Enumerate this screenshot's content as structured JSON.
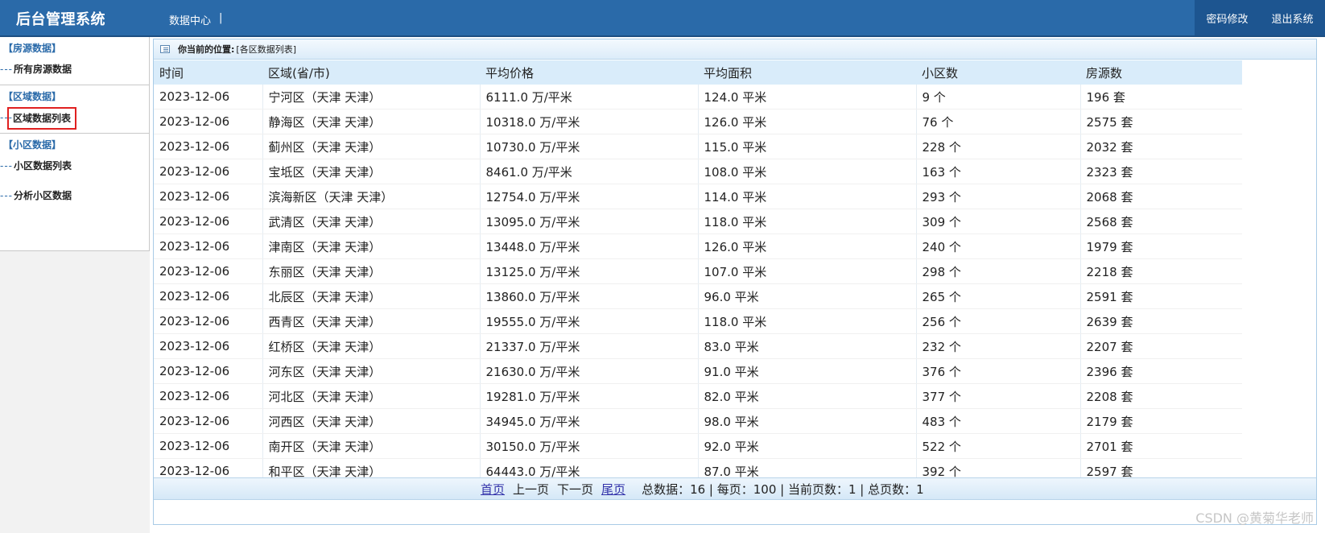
{
  "header": {
    "app_title": "后台管理系统",
    "nav_label": "数据中心",
    "nav_sep": "|",
    "change_password": "密码修改",
    "logout": "退出系统"
  },
  "sidebar": {
    "groups": [
      {
        "title": "【房源数据】",
        "items": [
          {
            "label": "所有房源数据",
            "active": false
          }
        ]
      },
      {
        "title": "【区域数据】",
        "items": [
          {
            "label": "区域数据列表",
            "active": true
          }
        ]
      },
      {
        "title": "【小区数据】",
        "items": [
          {
            "label": "小区数据列表",
            "active": false
          },
          {
            "label": "分析小区数据",
            "active": false
          }
        ]
      }
    ],
    "dash": "---"
  },
  "breadcrumb": {
    "prefix": "你当前的位置:",
    "path": "[各区数据列表]"
  },
  "table": {
    "columns": [
      "时间",
      "区域(省/市)",
      "平均价格",
      "平均面积",
      "小区数",
      "房源数"
    ],
    "rows": [
      [
        "2023-12-06",
        "宁河区（天津 天津）",
        "6111.0 万/平米",
        "124.0 平米",
        "9 个",
        "196 套"
      ],
      [
        "2023-12-06",
        "静海区（天津 天津）",
        "10318.0 万/平米",
        "126.0 平米",
        "76 个",
        "2575 套"
      ],
      [
        "2023-12-06",
        "蓟州区（天津 天津）",
        "10730.0 万/平米",
        "115.0 平米",
        "228 个",
        "2032 套"
      ],
      [
        "2023-12-06",
        "宝坻区（天津 天津）",
        "8461.0 万/平米",
        "108.0 平米",
        "163 个",
        "2323 套"
      ],
      [
        "2023-12-06",
        "滨海新区（天津 天津）",
        "12754.0 万/平米",
        "114.0 平米",
        "293 个",
        "2068 套"
      ],
      [
        "2023-12-06",
        "武清区（天津 天津）",
        "13095.0 万/平米",
        "118.0 平米",
        "309 个",
        "2568 套"
      ],
      [
        "2023-12-06",
        "津南区（天津 天津）",
        "13448.0 万/平米",
        "126.0 平米",
        "240 个",
        "1979 套"
      ],
      [
        "2023-12-06",
        "东丽区（天津 天津）",
        "13125.0 万/平米",
        "107.0 平米",
        "298 个",
        "2218 套"
      ],
      [
        "2023-12-06",
        "北辰区（天津 天津）",
        "13860.0 万/平米",
        "96.0 平米",
        "265 个",
        "2591 套"
      ],
      [
        "2023-12-06",
        "西青区（天津 天津）",
        "19555.0 万/平米",
        "118.0 平米",
        "256 个",
        "2639 套"
      ],
      [
        "2023-12-06",
        "红桥区（天津 天津）",
        "21337.0 万/平米",
        "83.0 平米",
        "232 个",
        "2207 套"
      ],
      [
        "2023-12-06",
        "河东区（天津 天津）",
        "21630.0 万/平米",
        "91.0 平米",
        "376 个",
        "2396 套"
      ],
      [
        "2023-12-06",
        "河北区（天津 天津）",
        "19281.0 万/平米",
        "82.0 平米",
        "377 个",
        "2208 套"
      ],
      [
        "2023-12-06",
        "河西区（天津 天津）",
        "34945.0 万/平米",
        "98.0 平米",
        "483 个",
        "2179 套"
      ],
      [
        "2023-12-06",
        "南开区（天津 天津）",
        "30150.0 万/平米",
        "92.0 平米",
        "522 个",
        "2701 套"
      ],
      [
        "2023-12-06",
        "和平区（天津 天津）",
        "64443.0 万/平米",
        "87.0 平米",
        "392 个",
        "2597 套"
      ]
    ]
  },
  "pager": {
    "first": "首页",
    "prev": "上一页",
    "next": "下一页",
    "last": "尾页",
    "stats": "总数据：16 | 每页：100 | 当前页数：1 | 总页数：1"
  },
  "watermark": "CSDN @黄菊华老师",
  "colors": {
    "header_bg": "#2a6aa9",
    "accent": "#2a6aa9",
    "active_border": "#e02020"
  }
}
